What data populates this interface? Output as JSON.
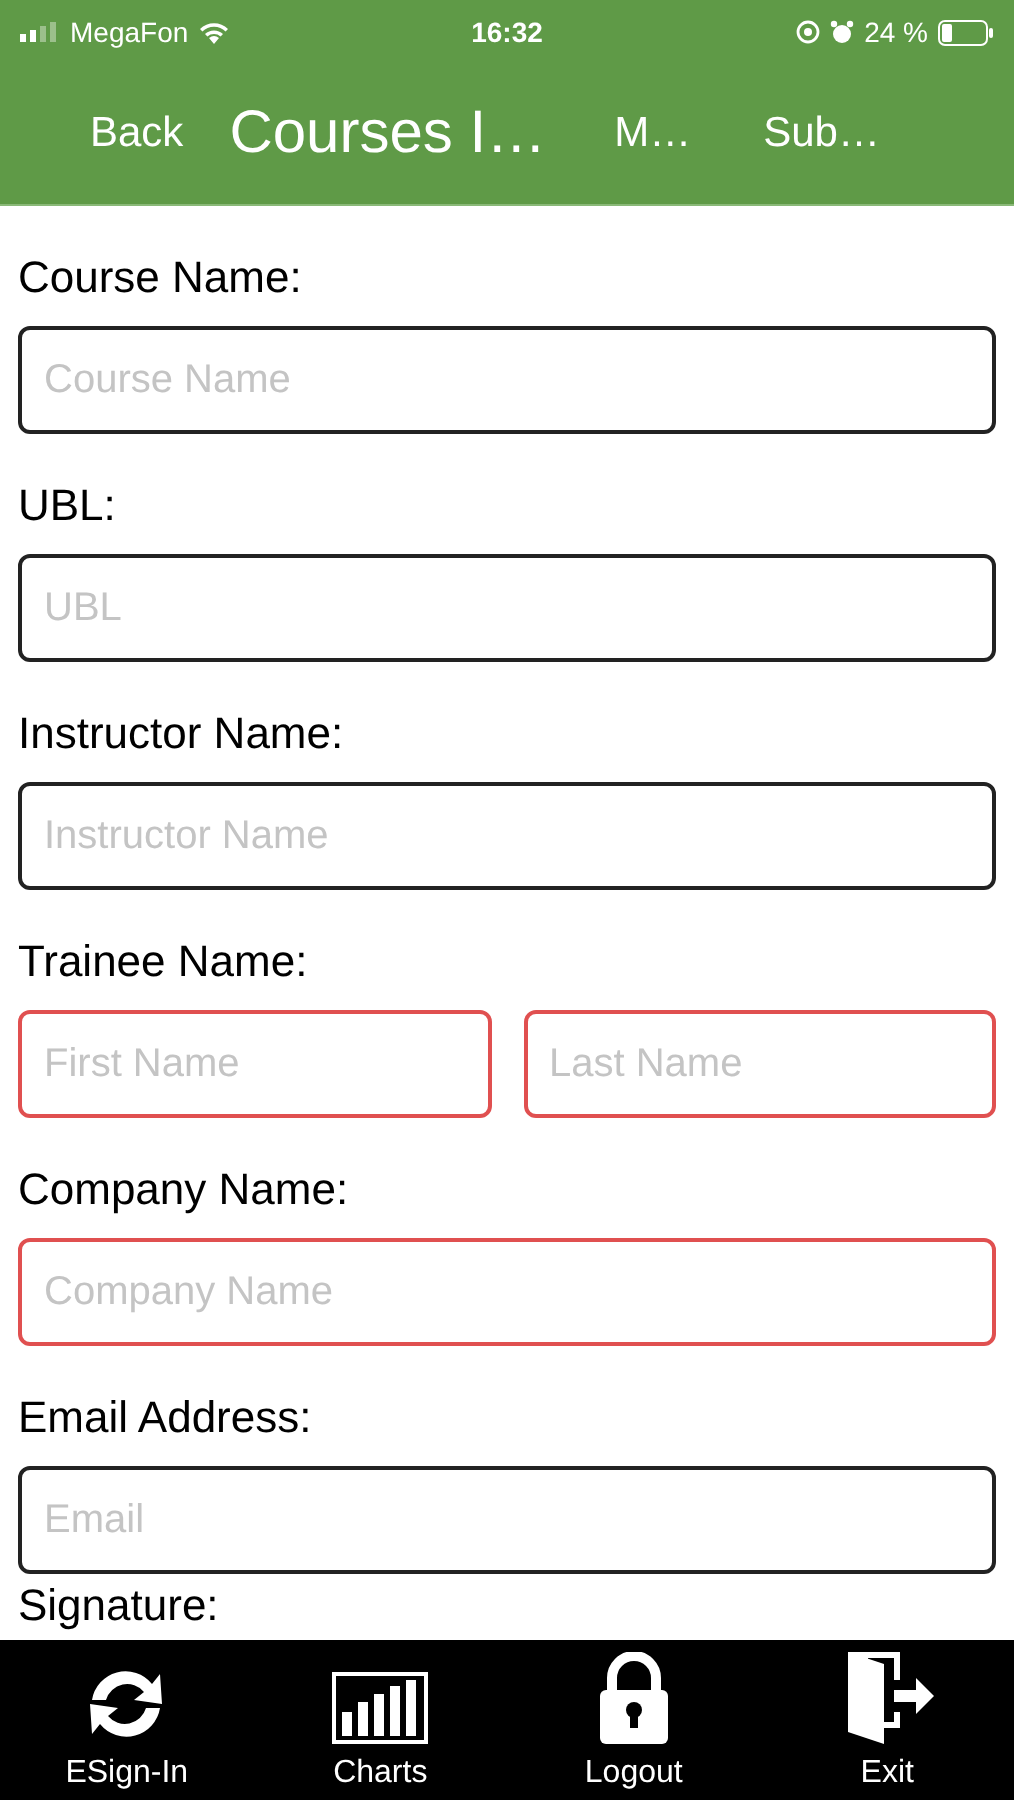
{
  "status_bar": {
    "carrier": "MegaFon",
    "time": "16:32",
    "battery": "24 %"
  },
  "nav_bar": {
    "back": "Back",
    "title": "Courses I…",
    "actions": [
      "M…",
      "Sub…"
    ]
  },
  "form": {
    "sections": [
      {
        "label": "Course Name:",
        "fields": [
          {
            "placeholder": "Course Name",
            "invalid": false
          }
        ]
      },
      {
        "label": "UBL:",
        "fields": [
          {
            "placeholder": "UBL",
            "invalid": false
          }
        ]
      },
      {
        "label": "Instructor Name:",
        "fields": [
          {
            "placeholder": "Instructor Name",
            "invalid": false
          }
        ]
      },
      {
        "label": "Trainee Name:",
        "fields": [
          {
            "placeholder": "First Name",
            "invalid": true
          },
          {
            "placeholder": "Last Name",
            "invalid": true
          }
        ]
      },
      {
        "label": "Company Name:",
        "fields": [
          {
            "placeholder": "Company Name",
            "invalid": true
          }
        ]
      },
      {
        "label": "Email Address:",
        "fields": [
          {
            "placeholder": "Email",
            "invalid": false
          }
        ]
      },
      {
        "label": "Signature:"
      }
    ]
  },
  "tab_bar": [
    {
      "kind": "sync",
      "label": "ESign-In"
    },
    {
      "kind": "chart",
      "label": "Charts"
    },
    {
      "kind": "lock",
      "label": "Logout"
    },
    {
      "kind": "exit",
      "label": "Exit"
    }
  ]
}
